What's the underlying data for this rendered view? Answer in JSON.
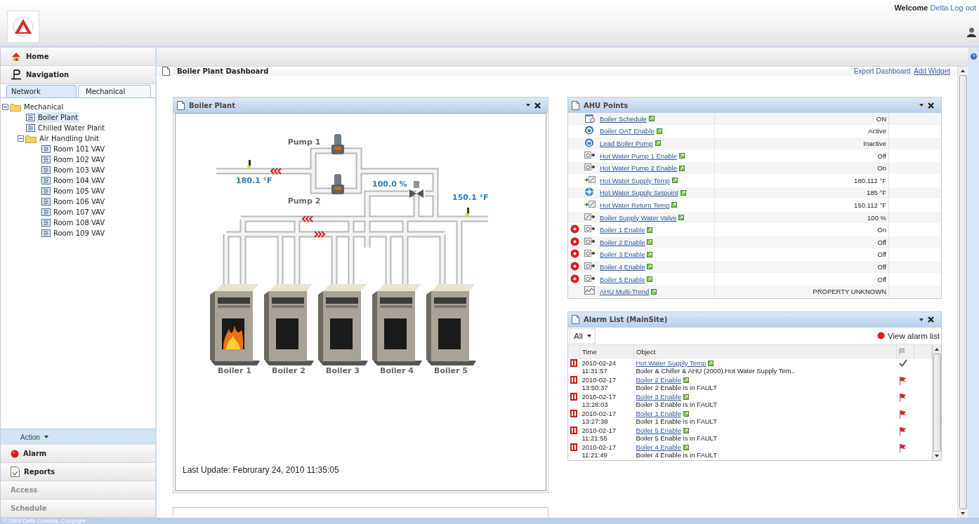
{
  "header": {
    "welcome": "Welcome",
    "user": "Delta",
    "logout": "Log out"
  },
  "sidebar": {
    "top_items": [
      {
        "label": "Home",
        "kind": "home"
      },
      {
        "label": "Navigation",
        "kind": "navigation"
      }
    ],
    "tabs": [
      {
        "label": "Network",
        "selected": false
      },
      {
        "label": "Mechanical",
        "selected": true
      }
    ],
    "tree": [
      {
        "label": "Mechanical",
        "kind": "folder",
        "expanded": true,
        "selected": false,
        "children": [
          {
            "label": "Boiler Plant",
            "kind": "object",
            "selected": true
          },
          {
            "label": "Chilled Water Plant",
            "kind": "object",
            "selected": false
          },
          {
            "label": "Air Handling Unit",
            "kind": "folder",
            "expanded": true,
            "selected": false,
            "children": [
              {
                "label": "Room 101 VAV",
                "kind": "object",
                "selected": false
              },
              {
                "label": "Room 102 VAV",
                "kind": "object",
                "selected": false
              },
              {
                "label": "Room 103 VAV",
                "kind": "object",
                "selected": false
              },
              {
                "label": "Room 104 VAV",
                "kind": "object",
                "selected": false
              },
              {
                "label": "Room 105 VAV",
                "kind": "object",
                "selected": false
              },
              {
                "label": "Room 106 VAV",
                "kind": "object",
                "selected": false
              },
              {
                "label": "Room 107 VAV",
                "kind": "object",
                "selected": false
              },
              {
                "label": "Room 108 VAV",
                "kind": "object",
                "selected": false
              },
              {
                "label": "Room 109 VAV",
                "kind": "object",
                "selected": false
              }
            ]
          }
        ]
      }
    ],
    "action": "Action",
    "bottom_items": [
      {
        "label": "Alarm",
        "kind": "alarm",
        "disabled": false
      },
      {
        "label": "Reports",
        "kind": "reports",
        "disabled": false
      },
      {
        "label": "Access",
        "kind": "plain",
        "disabled": true
      },
      {
        "label": "Schedule",
        "kind": "plain",
        "disabled": true
      }
    ]
  },
  "footer": "© 2009 Delta Controls. Copyright",
  "page": {
    "title": "Boiler Plant Dashboard",
    "links": [
      {
        "label": "Export Dashboard",
        "underlined": false
      },
      {
        "label": "Add Widget",
        "underlined": true
      }
    ]
  },
  "boiler_plant": {
    "title": "Boiler Plant",
    "pumps": [
      "Pump 1",
      "Pump 2"
    ],
    "readings": [
      "180.1 °F",
      "100.0 %",
      "150.1 °F"
    ],
    "boilers": [
      {
        "label": "Boiler 1",
        "firing": true
      },
      {
        "label": "Boiler 2",
        "firing": false
      },
      {
        "label": "Boiler 3",
        "firing": false
      },
      {
        "label": "Boiler 4",
        "firing": false
      },
      {
        "label": "Boiler 5",
        "firing": false
      }
    ],
    "last_update": "Last Update: Februrary 24, 2010 11:35:05"
  },
  "ahu_points": {
    "title": "AHU Points",
    "rows": [
      {
        "kind": "schedule",
        "name": "Boiler Schedule",
        "value": "ON",
        "alarm": false
      },
      {
        "kind": "binary-value",
        "name": "Boiler OAT Enable",
        "value": "Active",
        "alarm": false
      },
      {
        "kind": "binary-value",
        "name": "Lead Boiler Pump",
        "value": "Inactive",
        "alarm": false
      },
      {
        "kind": "binary-output",
        "name": "Hot Water Pump 1 Enable",
        "value": "Off",
        "alarm": false
      },
      {
        "kind": "binary-output",
        "name": "Hot Water Pump 2 Enable",
        "value": "On",
        "alarm": false
      },
      {
        "kind": "analog-input",
        "name": "Hot Water Supply Temp",
        "value": "180.112 °F",
        "alarm": false
      },
      {
        "kind": "analog-value",
        "name": "Hot Water Supply Setpoint",
        "value": "185 °F",
        "alarm": false
      },
      {
        "kind": "analog-input",
        "name": "Hot Water Return Temp",
        "value": "150.112 °F",
        "alarm": false
      },
      {
        "kind": "analog-output",
        "name": "Boiler Supply Water Valve",
        "value": "100 %",
        "alarm": false
      },
      {
        "kind": "binary-output",
        "name": "Boiler 1 Enable",
        "value": "On",
        "alarm": true
      },
      {
        "kind": "binary-output",
        "name": "Boiler 2 Enable",
        "value": "Off",
        "alarm": true
      },
      {
        "kind": "binary-output",
        "name": "Boiler 3 Enable",
        "value": "Off",
        "alarm": true
      },
      {
        "kind": "binary-output",
        "name": "Boiler 4 Enable",
        "value": "Off",
        "alarm": true
      },
      {
        "kind": "binary-output",
        "name": "Boiler 5 Enable",
        "value": "Off",
        "alarm": true
      },
      {
        "kind": "trend",
        "name": "AHU Multi-Trend",
        "value": "PROPERTY UNKNOWN",
        "alarm": false
      }
    ]
  },
  "alarm_list": {
    "title": "Alarm List (MainSite)",
    "filter": "All",
    "view_link": "View alarm list",
    "columns": [
      "Time",
      "Object"
    ],
    "rows": [
      {
        "date": "2010-02-24",
        "time": "11:31:57",
        "object": "Hot Water Supply Temp",
        "description": "Boiler & Chiller & AHU (2000).Hot Water Supply Tem..",
        "acknowledged": true
      },
      {
        "date": "2010-02-17",
        "time": "13:50:37",
        "object": "Boiler 2 Enable",
        "description": "Boiler 2 Enable is in FAULT",
        "acknowledged": false
      },
      {
        "date": "2010-02-17",
        "time": "13:28:03",
        "object": "Boiler 3 Enable",
        "description": "Boiler 3 Enable is in FAULT",
        "acknowledged": false
      },
      {
        "date": "2010-02-17",
        "time": "13:27:38",
        "object": "Boiler 1 Enable",
        "description": "Boiler 1 Enable is in FAULT",
        "acknowledged": false
      },
      {
        "date": "2010-02-17",
        "time": "11:21:55",
        "object": "Boiler 5 Enable",
        "description": "Boiler 5 Enable is in FAULT",
        "acknowledged": false
      },
      {
        "date": "2010-02-17",
        "time": "11:21:49",
        "object": "Boiler 4 Enable",
        "description": "Boiler 4 Enable is in FAULT",
        "acknowledged": false
      }
    ]
  }
}
